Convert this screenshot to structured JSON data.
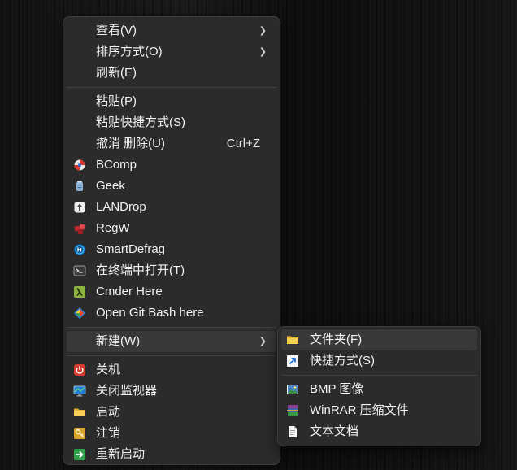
{
  "context_menu": {
    "view": {
      "label": "查看(V)"
    },
    "sort": {
      "label": "排序方式(O)"
    },
    "refresh": {
      "label": "刷新(E)"
    },
    "paste": {
      "label": "粘贴(P)"
    },
    "paste_shortcut": {
      "label": "粘贴快捷方式(S)"
    },
    "undo_delete": {
      "label": "撤消 删除(U)",
      "shortcut": "Ctrl+Z"
    },
    "bcomp": {
      "label": "BComp",
      "icon": "bcomp-icon"
    },
    "geek": {
      "label": "Geek",
      "icon": "geek-icon"
    },
    "landrop": {
      "label": "LANDrop",
      "icon": "landrop-icon"
    },
    "regw": {
      "label": "RegW",
      "icon": "regw-icon"
    },
    "smartdefrag": {
      "label": "SmartDefrag",
      "icon": "smartdefrag-icon"
    },
    "open_terminal": {
      "label": "在终端中打开(T)",
      "icon": "terminal-icon"
    },
    "cmder": {
      "label": "Cmder Here",
      "icon": "cmder-icon"
    },
    "git_bash": {
      "label": "Open Git Bash here",
      "icon": "git-icon"
    },
    "new": {
      "label": "新建(W)"
    },
    "shutdown": {
      "label": "关机",
      "icon": "power-icon"
    },
    "monitor_off": {
      "label": "关闭监视器",
      "icon": "monitor-icon"
    },
    "startup": {
      "label": "启动",
      "icon": "folder-icon"
    },
    "logoff": {
      "label": "注销",
      "icon": "key-icon"
    },
    "restart": {
      "label": "重新启动",
      "icon": "restart-arrow-icon"
    }
  },
  "new_submenu": {
    "folder": {
      "label": "文件夹(F)",
      "icon": "folder-icon"
    },
    "shortcut": {
      "label": "快捷方式(S)",
      "icon": "shortcut-arrow-icon"
    },
    "bmp": {
      "label": "BMP 图像",
      "icon": "bmp-image-icon"
    },
    "winrar": {
      "label": "WinRAR 压缩文件",
      "icon": "winrar-icon"
    },
    "text": {
      "label": "文本文档",
      "icon": "text-document-icon"
    }
  },
  "colors": {
    "menu_bg": "#2b2b2b",
    "hover_bg": "#393939",
    "text": "#f2f2f2",
    "separator": "#414141"
  }
}
